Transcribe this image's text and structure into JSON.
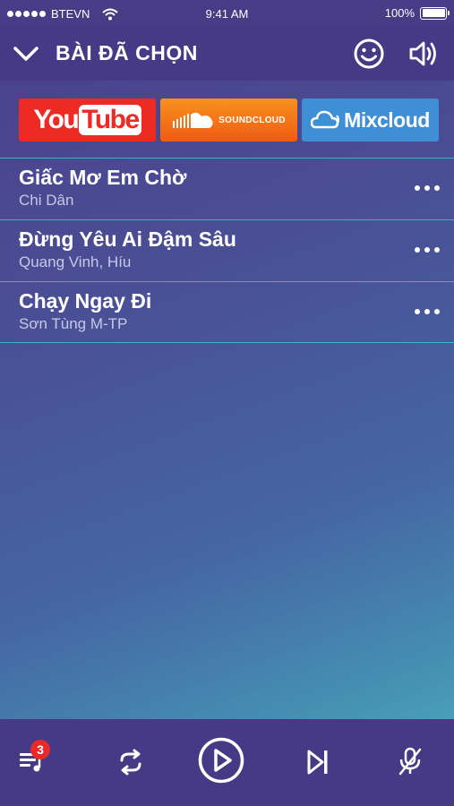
{
  "status_bar": {
    "carrier": "BTEVN",
    "time": "9:41 AM",
    "battery_text": "100%"
  },
  "header": {
    "title": "BÀI ĐÃ CHỌN",
    "icons": [
      "chevron-down-icon",
      "smile-icon",
      "speaker-icon"
    ]
  },
  "sources": [
    {
      "name": "YouTube",
      "label_part1": "You",
      "label_part2": "Tube",
      "color": "#ee2a24"
    },
    {
      "name": "SoundCloud",
      "label": "SOUNDCLOUD",
      "color": "#f26f1a"
    },
    {
      "name": "Mixcloud",
      "label": "Mixcloud",
      "color": "#3e8fd6"
    }
  ],
  "songs": [
    {
      "title": "Giấc Mơ Em Chờ",
      "artist": "Chi Dân"
    },
    {
      "title": "Đừng Yêu Ai Đậm Sâu",
      "artist": "Quang Vinh, Híu"
    },
    {
      "title": "Chạy Ngay Đi",
      "artist": "Sơn Tùng M-TP"
    }
  ],
  "player": {
    "queue_count": "3",
    "icons": [
      "playlist-icon",
      "repeat-icon",
      "play-icon",
      "skip-next-icon",
      "mic-off-icon"
    ]
  },
  "colors": {
    "bar_bg": "#463a86",
    "divider": "#3fb0c0",
    "badge": "#e82a2a"
  }
}
